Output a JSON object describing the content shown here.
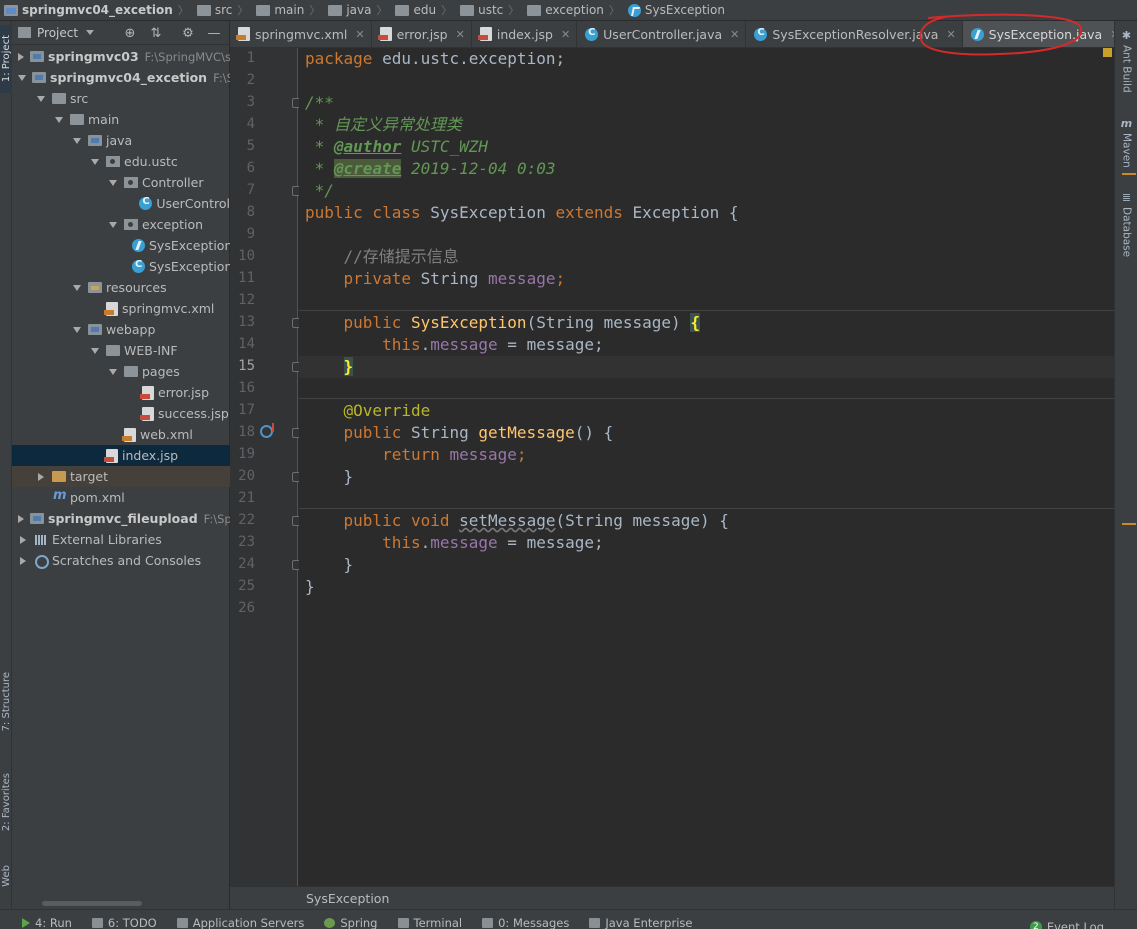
{
  "breadcrumb": {
    "items": [
      "springmvc04_excetion",
      "src",
      "main",
      "java",
      "edu",
      "ustc",
      "exception",
      "SysException"
    ]
  },
  "left_strip": {
    "project": "1: Project",
    "structure": "7: Structure",
    "favorites": "2: Favorites",
    "web": "Web"
  },
  "project_panel": {
    "title": "Project",
    "tree": [
      {
        "label": "springmvc03",
        "path": "F:\\SpringMVC\\sp",
        "bold": true,
        "arrow": "right",
        "icon": "folder-blue",
        "indent": 0
      },
      {
        "label": "springmvc04_excetion",
        "path": "F:\\Sprin",
        "bold": true,
        "arrow": "down",
        "icon": "folder-blue",
        "indent": 0
      },
      {
        "label": "src",
        "arrow": "down",
        "icon": "folder",
        "indent": 1
      },
      {
        "label": "main",
        "arrow": "down",
        "icon": "folder",
        "indent": 2
      },
      {
        "label": "java",
        "arrow": "down",
        "icon": "folder-blue",
        "indent": 3
      },
      {
        "label": "edu.ustc",
        "arrow": "down",
        "icon": "pkg",
        "indent": 4
      },
      {
        "label": "Controller",
        "arrow": "down",
        "icon": "pkg",
        "indent": 5
      },
      {
        "label": "UserControl",
        "arrow": "none",
        "icon": "cls",
        "indent": 6
      },
      {
        "label": "exception",
        "arrow": "down",
        "icon": "pkg",
        "indent": 5
      },
      {
        "label": "SysException",
        "arrow": "none",
        "icon": "exc",
        "indent": 6
      },
      {
        "label": "SysException",
        "arrow": "none",
        "icon": "cls",
        "indent": 6
      },
      {
        "label": "resources",
        "arrow": "down",
        "icon": "folder-res",
        "indent": 3
      },
      {
        "label": "springmvc.xml",
        "arrow": "none",
        "icon": "xml",
        "indent": 4
      },
      {
        "label": "webapp",
        "arrow": "down",
        "icon": "folder-blue",
        "indent": 3
      },
      {
        "label": "WEB-INF",
        "arrow": "down",
        "icon": "folder",
        "indent": 4
      },
      {
        "label": "pages",
        "arrow": "down",
        "icon": "folder",
        "indent": 5
      },
      {
        "label": "error.jsp",
        "arrow": "none",
        "icon": "jsp",
        "indent": 6
      },
      {
        "label": "success.jsp",
        "arrow": "none",
        "icon": "jsp",
        "indent": 6
      },
      {
        "label": "web.xml",
        "arrow": "none",
        "icon": "xml",
        "indent": 5
      },
      {
        "label": "index.jsp",
        "arrow": "none",
        "icon": "jsp",
        "indent": 4,
        "selected": true
      },
      {
        "label": "target",
        "arrow": "right",
        "icon": "folder-target",
        "indent": 1,
        "dim": true
      },
      {
        "label": "pom.xml",
        "arrow": "none",
        "icon": "pom",
        "indent": 1
      },
      {
        "label": "springmvc_fileupload",
        "path": "F:\\Spri",
        "bold": true,
        "arrow": "right",
        "icon": "folder-blue",
        "indent": 0
      },
      {
        "label": "External Libraries",
        "arrow": "right",
        "icon": "lib",
        "indent": 0
      },
      {
        "label": "Scratches and Consoles",
        "arrow": "right",
        "icon": "scr",
        "indent": 0
      }
    ]
  },
  "tabs": [
    {
      "label": "springmvc.xml",
      "icon": "xml"
    },
    {
      "label": "error.jsp",
      "icon": "jsp"
    },
    {
      "label": "index.jsp",
      "icon": "jsp"
    },
    {
      "label": "UserController.java",
      "icon": "cls"
    },
    {
      "label": "SysExceptionResolver.java",
      "icon": "cls"
    },
    {
      "label": "SysException.java",
      "icon": "exc",
      "active": true
    }
  ],
  "editor": {
    "line_numbers": [
      "1",
      "2",
      "3",
      "4",
      "5",
      "6",
      "7",
      "8",
      "9",
      "10",
      "11",
      "12",
      "13",
      "14",
      "15",
      "16",
      "17",
      "18",
      "19",
      "20",
      "21",
      "22",
      "23",
      "24",
      "25",
      "26"
    ],
    "current_line": 15,
    "code": {
      "l1_kw": "package",
      "l1_rest": " edu.ustc.exception;",
      "l3": "/**",
      "l4": " * 自定义异常处理类",
      "l5_star": " * ",
      "l5_tag": "@author",
      "l5_rest": " USTC_WZH",
      "l6_star": " * ",
      "l6_tag": "@create",
      "l6_rest": " 2019-12-04 0:03",
      "l7": " */",
      "l8_kw1": "public class",
      "l8_name": " SysException ",
      "l8_kw2": "extends",
      "l8_rest": " Exception {",
      "l10": "    //存储提示信息",
      "l11_kw": "    private",
      "l11_type": " String ",
      "l11_fld": "message",
      "l11_end": ";",
      "l13_kw": "    public",
      "l13_fn": " SysException",
      "l13_rest": "(String message) ",
      "l13_brace": "{",
      "l14_kw": "        this",
      "l14_dot": ".",
      "l14_fld": "message",
      "l14_rest": " = message;",
      "l15_brace": "}",
      "l15_indent": "    ",
      "l17": "    @Override",
      "l18_kw": "    public",
      "l18_type": " String ",
      "l18_fn": "getMessage",
      "l18_rest": "() {",
      "l19_kw": "        return",
      "l19_fld": " message",
      "l19_end": ";",
      "l20": "    }",
      "l22_kw": "    public void",
      "l22_sp": " ",
      "l22_fn": "setMessage",
      "l22_rest": "(String message) {",
      "l23_kw": "        this",
      "l23_dot": ".",
      "l23_fld": "message",
      "l23_rest": " = message;",
      "l24": "    }",
      "l25": "}"
    }
  },
  "editor_breadcrumb": "SysException",
  "right_strip": {
    "ant": "Ant Build",
    "maven": "Maven",
    "database": "Database"
  },
  "statusbar": {
    "run": "4: Run",
    "todo": "6: TODO",
    "servers": "Application Servers",
    "spring": "Spring",
    "terminal": "Terminal",
    "messages": "0: Messages",
    "enterprise": "Java Enterprise",
    "event_count": "2",
    "event_log": "Event Log"
  },
  "colors": {
    "background": "#2b2b2b",
    "panel": "#3c3f41",
    "keyword": "#cc7832",
    "function": "#ffc66d",
    "field": "#9876aa",
    "annotation": "#bbb529",
    "doc_comment": "#629755",
    "annotation_oval": "#d42a2a"
  }
}
